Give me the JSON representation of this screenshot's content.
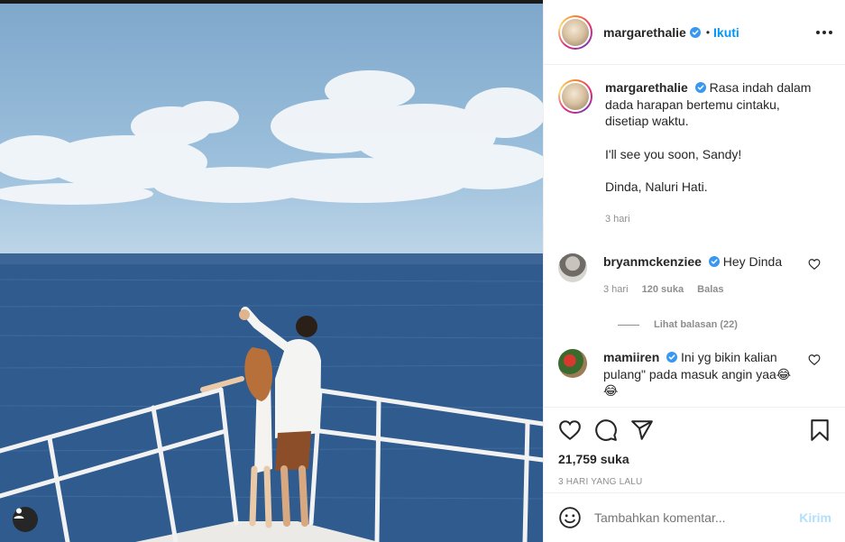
{
  "post": {
    "username": "margarethalie",
    "follow_label": "Ikuti",
    "dot": "•"
  },
  "caption": {
    "username": "margarethalie",
    "lines": [
      "Rasa indah dalam dada harapan bertemu cintaku, disetiap waktu.",
      "I'll see you soon, Sandy!",
      "Dinda, Naluri Hati."
    ],
    "time": "3 hari"
  },
  "comments": [
    {
      "username": "bryanmckenziee",
      "text": "Hey Dinda",
      "time": "3 hari",
      "likes": "120 suka",
      "reply_label": "Balas",
      "view_replies": "Lihat balasan (22)"
    },
    {
      "username": "mamiiren",
      "text": "Ini yg bikin kalian pulang\" pada masuk angin yaa😂",
      "emoji": "😂"
    }
  ],
  "stats": {
    "likes": "21,759 suka",
    "time_ago": "3 HARI YANG LALU"
  },
  "add_comment": {
    "placeholder": "Tambahkan komentar...",
    "send_label": "Kirim"
  },
  "icons": {
    "verified": "verified-badge-icon",
    "more": "more-options-icon",
    "like": "heart-icon",
    "comment": "comment-icon",
    "share": "share-icon",
    "save": "bookmark-icon",
    "emoji": "emoji-icon",
    "tag": "user-tag-icon"
  },
  "colors": {
    "accent": "#0095f6",
    "verified": "#3897f0",
    "muted": "#8e8e8e",
    "send_disabled": "#b2dffc"
  }
}
